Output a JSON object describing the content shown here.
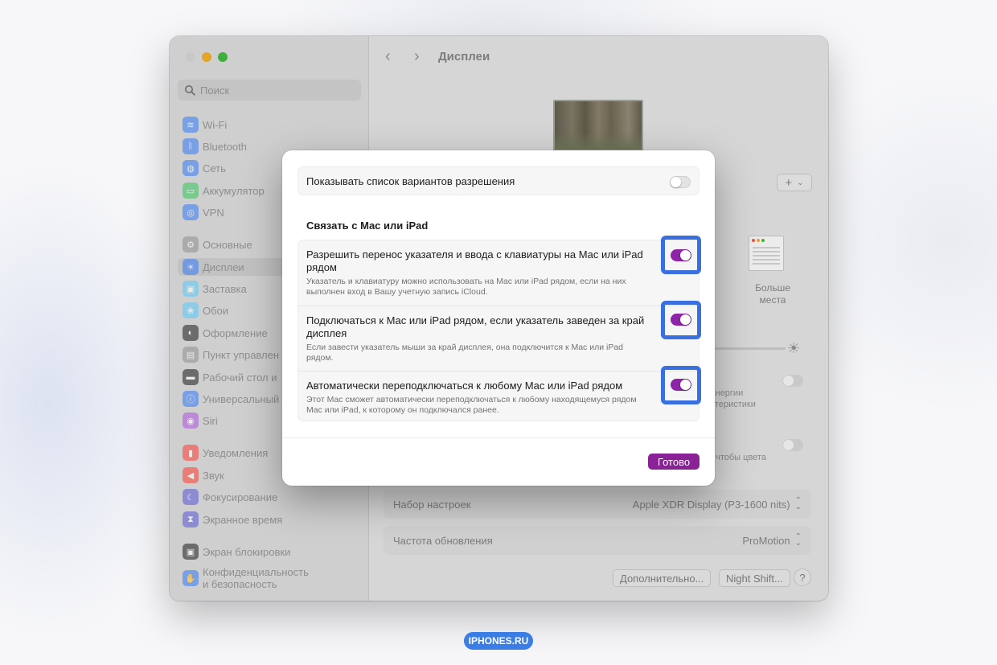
{
  "window": {
    "title": "Дисплеи",
    "search_placeholder": "Поиск"
  },
  "sidebar": {
    "items": [
      {
        "label": "Wi-Fi",
        "icon": "wifi-icon",
        "color": "#3478f6"
      },
      {
        "label": "Bluetooth",
        "icon": "bluetooth-icon",
        "color": "#3478f6"
      },
      {
        "label": "Сеть",
        "icon": "globe-icon",
        "color": "#3478f6"
      },
      {
        "label": "Аккумулятор",
        "icon": "battery-icon",
        "color": "#34c759"
      },
      {
        "label": "VPN",
        "icon": "vpn-icon",
        "color": "#3478f6"
      },
      {
        "label": "Основные",
        "icon": "gear-icon",
        "color": "#8e8e93"
      },
      {
        "label": "Дисплеи",
        "icon": "display-icon",
        "color": "#3478f6"
      },
      {
        "label": "Заставка",
        "icon": "screensaver-icon",
        "color": "#5ac8fa"
      },
      {
        "label": "Обои",
        "icon": "wallpaper-icon",
        "color": "#5ac8fa"
      },
      {
        "label": "Оформление",
        "icon": "appearance-icon",
        "color": "#1d1d1f"
      },
      {
        "label": "Пункт управлен",
        "icon": "control-center-icon",
        "color": "#8e8e93"
      },
      {
        "label": "Рабочий стол и",
        "icon": "desktop-icon",
        "color": "#1d1d1f"
      },
      {
        "label": "Универсальный",
        "icon": "accessibility-icon",
        "color": "#3478f6"
      },
      {
        "label": "Siri",
        "icon": "siri-icon",
        "color": "#af52de"
      },
      {
        "label": "Уведомления",
        "icon": "notifications-icon",
        "color": "#ff3b30"
      },
      {
        "label": "Звук",
        "icon": "sound-icon",
        "color": "#ff3b30"
      },
      {
        "label": "Фокусирование",
        "icon": "focus-icon",
        "color": "#5856d6"
      },
      {
        "label": "Экранное время",
        "icon": "screen-time-icon",
        "color": "#5856d6"
      },
      {
        "label": "Экран блокировки",
        "icon": "lock-screen-icon",
        "color": "#1d1d1f"
      },
      {
        "label": "Конфиденциальность",
        "label2": "и безопасность",
        "icon": "privacy-icon",
        "color": "#3478f6"
      }
    ]
  },
  "main": {
    "add_button": "+",
    "more_space_label_1": "Больше",
    "more_space_label_2": "места",
    "partial_energy_1": "энергии",
    "partial_energy_2": "ктеристики",
    "partial_colors": ", чтобы цвета",
    "preset_label": "Набор настроек",
    "preset_value": "Apple XDR Display (P3-1600 nits)",
    "refresh_label": "Частота обновления",
    "refresh_value": "ProMotion",
    "advanced_button": "Дополнительно...",
    "night_shift_button": "Night Shift...",
    "help_button": "?"
  },
  "dialog": {
    "show_resolutions_label": "Показывать список вариантов разрешения",
    "show_resolutions_on": false,
    "section_title": "Связать с Mac или iPad",
    "options": [
      {
        "title": "Разрешить перенос указателя и ввода с клавиатуры на Mac или iPad рядом",
        "description": "Указатель и клавиатуру можно использовать на Mac или iPad рядом, если на них выполнен вход в Вашу учетную запись iCloud.",
        "on": true
      },
      {
        "title": "Подключаться к Mac или iPad рядом, если указатель заведен за край дисплея",
        "description": "Если завести указатель мыши за край дисплея, она подключится к Mac или iPad рядом.",
        "on": true
      },
      {
        "title": "Автоматически переподключаться к любому Mac или iPad рядом",
        "description": "Этот Mac сможет автоматически переподключаться к любому находящемуся рядом Mac или iPad, к которому он подключался ранее.",
        "on": true
      }
    ],
    "done_button": "Готово",
    "accent_color": "#8a2196",
    "highlight_color": "#3a6fe0"
  },
  "watermark": "IPHONES.RU"
}
